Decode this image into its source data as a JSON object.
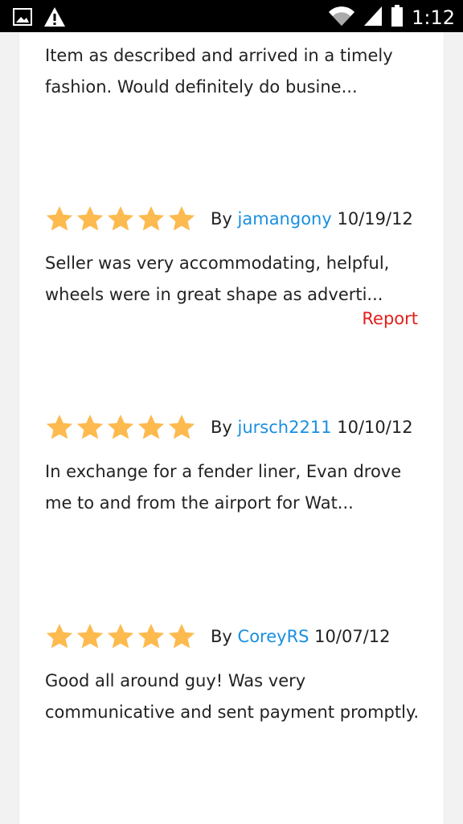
{
  "status_bar": {
    "time": "1:12",
    "icons": [
      "gallery-icon",
      "warning-icon",
      "wifi-icon",
      "signal-icon",
      "battery-icon"
    ]
  },
  "reviews": [
    {
      "text": "Item as described and arrived in a timely fashion. Would definitely do busine..."
    },
    {
      "rating": 5,
      "by_label": "By",
      "user": "jamangony",
      "date": "10/19/12",
      "text": "Seller was very accommodating, helpful, wheels were in great shape as adverti...",
      "report_label": "Report"
    },
    {
      "rating": 5,
      "by_label": "By",
      "user": "jursch2211",
      "date": "10/10/12",
      "text": "In exchange for a fender liner, Evan drove me to and from the airport for Wat..."
    },
    {
      "rating": 5,
      "by_label": "By",
      "user": "CoreyRS",
      "date": "10/07/12",
      "text": "Good all around guy! Was very communicative and sent payment promptly."
    }
  ],
  "colors": {
    "star": "#FDBA4F",
    "username_link": "#1A8FE0",
    "report_link": "#E0201B"
  }
}
